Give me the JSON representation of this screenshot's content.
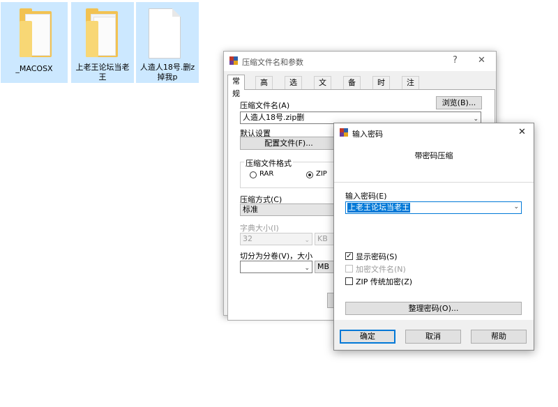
{
  "desktop": {
    "icons": [
      {
        "label": "_MACOSX",
        "type": "folder-icon"
      },
      {
        "label_line1": "上老王论坛当老",
        "label_line2": "王",
        "type": "folder-icon"
      },
      {
        "label_line1": "人造人18号.删z",
        "label_line2": "掉我p",
        "type": "file-icon"
      }
    ]
  },
  "main_dialog": {
    "title": "压缩文件名和参数",
    "help_btn": "?",
    "close_btn": "✕",
    "tabs": [
      "常规",
      "高级",
      "选项",
      "文件",
      "备份",
      "时间",
      "注释"
    ],
    "active_tab": "常规",
    "browse_label": "浏览(B)...",
    "archive_name_label": "压缩文件名(A)",
    "archive_name_value": "人造人18号.zip删",
    "default_settings_label": "默认设置",
    "profiles_label": "配置文件(F)...",
    "format_group_label": "压缩文件格式",
    "format_options": [
      "RAR",
      "ZIP"
    ],
    "format_selected": "ZIP",
    "method_label": "压缩方式(C)",
    "method_value": "标准",
    "dict_label": "字典大小(I)",
    "dict_value": "32",
    "dict_unit": "KB",
    "split_label": "切分为分卷(V)，大小",
    "split_value": "",
    "split_unit": "MB"
  },
  "password_dialog": {
    "title": "输入密码",
    "close_btn": "✕",
    "heading": "带密码压缩",
    "password_label": "输入密码(E)",
    "password_value": "上老王论坛当老王",
    "show_password_label": "显示密码(S)",
    "show_password_checked": true,
    "encrypt_names_label": "加密文件名(N)",
    "encrypt_names_checked": false,
    "zip_legacy_label": "ZIP 传统加密(Z)",
    "zip_legacy_checked": false,
    "organize_label": "整理密码(O)...",
    "ok_label": "确定",
    "cancel_label": "取消",
    "help_label": "帮助"
  },
  "colors": {
    "selection_blue": "#0078d7",
    "icon_selected_bg": "#cce8ff",
    "folder_yellow": "#f8d775",
    "winrar_red": "#c0392b",
    "winrar_blue": "#2e5fa8"
  }
}
